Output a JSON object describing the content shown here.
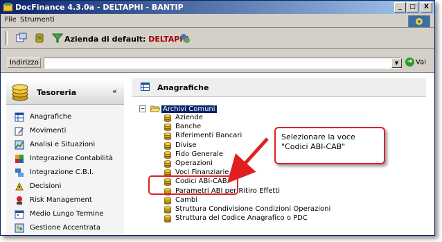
{
  "window": {
    "title": "DocFinance 4.3.0a  - DELTAPHI - BANTIP",
    "controls": [
      "_",
      "□",
      "X"
    ]
  },
  "menu": [
    "File",
    "Strumenti"
  ],
  "toolbar": {
    "azienda_label": "Azienda di default:",
    "azienda_value": "DELTAPHI"
  },
  "address": {
    "label": "Indirizzo",
    "value": "",
    "go_label": "Vai"
  },
  "sidebar": {
    "title": "Tesoreria",
    "collapse_glyph": "«",
    "items": [
      {
        "label": "Anagrafiche",
        "icon": "table-icon"
      },
      {
        "label": "Movimenti",
        "icon": "pencil-icon"
      },
      {
        "label": "Analisi e Situazioni",
        "icon": "chart-icon"
      },
      {
        "label": "Integrazione Contabilità",
        "icon": "puzzle-icon"
      },
      {
        "label": "Integrazione C.B.I.",
        "icon": "network-icon"
      },
      {
        "label": "Decisioni",
        "icon": "decision-icon"
      },
      {
        "label": "Risk Management",
        "icon": "risk-icon"
      },
      {
        "label": "Medio Lungo Termine",
        "icon": "calendar-icon"
      },
      {
        "label": "Gestione Accentrata",
        "icon": "group-icon"
      }
    ]
  },
  "main": {
    "title": "Anagrafiche",
    "tree_root": {
      "label": "Archivi Comuni",
      "expander": "−"
    },
    "tree_items": [
      "Aziende",
      "Banche",
      "Riferimenti Bancari",
      "Divise",
      "Fido Generale",
      "Operazioni",
      "Voci Finanziarie",
      "Codici ABI-CAB",
      "Parametri ABI per Ritiro Effetti",
      "Cambi",
      "Struttura Condivisione Condizioni Operazioni",
      "Struttura del Codice Anagrafico o PDC"
    ]
  },
  "callout": {
    "line1": "Selezionare la voce",
    "line2": "\"Codici ABI-CAB\""
  },
  "colors": {
    "highlight": "#e02020",
    "selection": "#0a246a",
    "azienda_value": "#a00000"
  }
}
